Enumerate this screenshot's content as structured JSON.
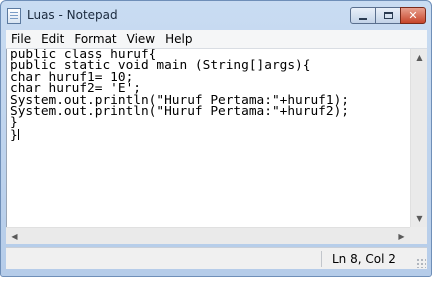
{
  "window": {
    "title": "Luas - Notepad",
    "icon": "notepad-icon",
    "caption_buttons": [
      "minimize-icon",
      "maximize-icon",
      "close-icon"
    ]
  },
  "menu": {
    "items": [
      "File",
      "Edit",
      "Format",
      "View",
      "Help"
    ]
  },
  "editor": {
    "lines": [
      "public class huruf{",
      "public static void main (String[]args){",
      "char huruf1= 10;",
      "char huruf2= 'E';",
      "System.out.println(\"Huruf Pertama:\"+huruf1);",
      "System.out.println(\"Huruf Pertama:\"+huruf2);",
      "}",
      "}"
    ]
  },
  "scrollbars": {
    "vertical_icons": [
      "scroll-up-arrow-icon",
      "scroll-down-arrow-icon"
    ],
    "horizontal_icons": [
      "scroll-left-arrow-icon",
      "scroll-right-arrow-icon"
    ]
  },
  "status": {
    "position": "Ln 8, Col 2"
  },
  "colors": {
    "title_bar": "#c9dcf2",
    "close_button": "#c7452a",
    "menu_bar": "#f5f6f7",
    "editor_background": "#ffffff"
  }
}
